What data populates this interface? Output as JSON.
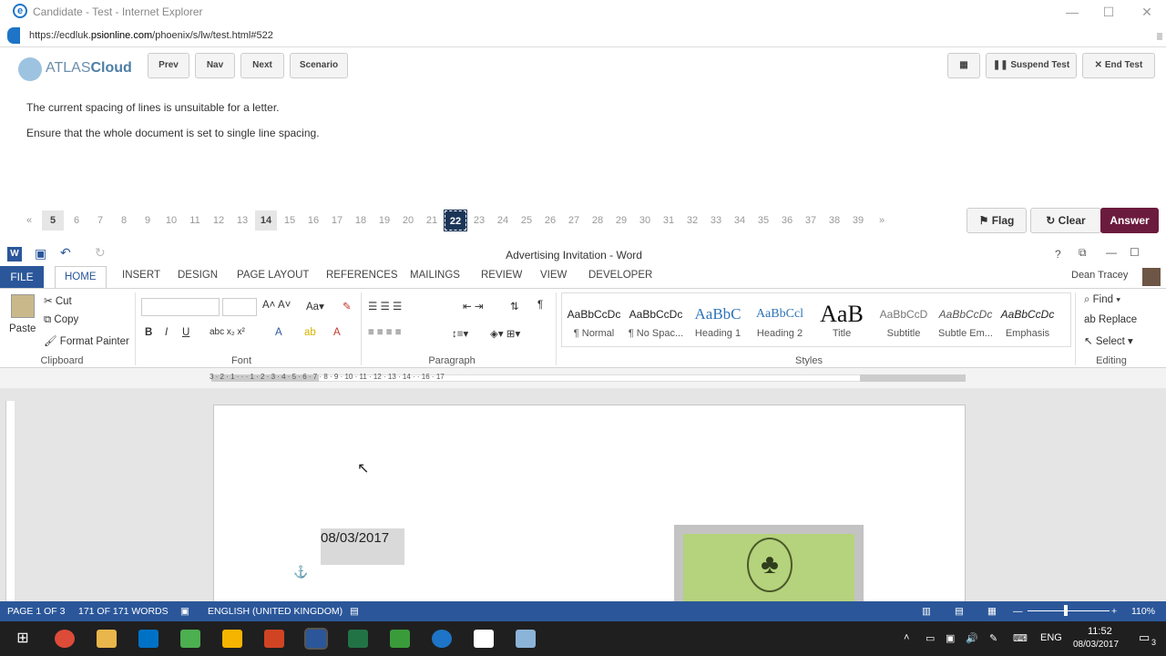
{
  "ie": {
    "title": "Candidate - Test - Internet Explorer",
    "url_prefix": "https://ecdluk.",
    "url_domain": "psionline.com",
    "url_suffix": "/phoenix/s/lw/test.html#522"
  },
  "atlas": {
    "logo_a": "ATLAS",
    "logo_b": "Cloud",
    "prev_label": "Prev",
    "nav_label": "Nav",
    "next_label": "Next",
    "scenario_label": "Scenario",
    "suspend_label": "Suspend Test",
    "end_label": "End Test"
  },
  "question": {
    "line1": "The current spacing of lines is unsuitable for a letter.",
    "line2": "Ensure that the whole document is set to single line spacing."
  },
  "qnav": {
    "prev_arrow": "«",
    "next_arrow": "»",
    "numbers": [
      "5",
      "6",
      "7",
      "8",
      "9",
      "10",
      "11",
      "12",
      "13",
      "14",
      "15",
      "16",
      "17",
      "18",
      "19",
      "20",
      "21",
      "22",
      "23",
      "24",
      "25",
      "26",
      "27",
      "28",
      "29",
      "30",
      "31",
      "32",
      "33",
      "34",
      "35",
      "36",
      "37",
      "38",
      "39"
    ],
    "flag_label": "Flag",
    "clear_label": "Clear",
    "answer_label": "Answer",
    "current": "22",
    "answered": [
      "5",
      "14"
    ]
  },
  "word": {
    "title": "Advertising Invitation - Word",
    "user": "Dean Tracey",
    "tabs": [
      "HOME",
      "INSERT",
      "DESIGN",
      "PAGE LAYOUT",
      "REFERENCES",
      "MAILINGS",
      "REVIEW",
      "VIEW",
      "DEVELOPER"
    ],
    "file_tab": "FILE",
    "clipboard": {
      "paste": "Paste",
      "cut": "Cut",
      "copy": "Copy",
      "format_painter": "Format Painter",
      "label": "Clipboard"
    },
    "font_label": "Font",
    "paragraph_label": "Paragraph",
    "styles_label": "Styles",
    "editing": {
      "find": "Find",
      "replace": "Replace",
      "select": "Select",
      "label": "Editing"
    },
    "styles": [
      {
        "preview": "AaBbCcDc",
        "name": "¶ Normal"
      },
      {
        "preview": "AaBbCcDc",
        "name": "¶ No Spac..."
      },
      {
        "preview": "AaBbC",
        "name": "Heading 1"
      },
      {
        "preview": "AaBbCcl",
        "name": "Heading 2"
      },
      {
        "preview": "AaB",
        "name": "Title"
      },
      {
        "preview": "AaBbCcD",
        "name": "Subtitle"
      },
      {
        "preview": "AaBbCcDc",
        "name": "Subtle Em..."
      },
      {
        "preview": "AaBbCcDc",
        "name": "Emphasis"
      }
    ],
    "ruler_numbers": "3 · 2 · 1 · · · 1 · 2 · 3 · 4 · 5 · 6 · 7 · 8 · 9 · 10 · 11 · 12 · 13 · 14 · · 16 · 17",
    "doc_date": "08/03/2017",
    "status": {
      "page": "PAGE 1 OF 3",
      "words": "171 OF 171 WORDS",
      "language": "ENGLISH (UNITED KINGDOM)",
      "zoom": "110%"
    }
  },
  "taskbar": {
    "lang": "ENG",
    "time": "11:52",
    "date": "08/03/2017",
    "notif_count": "3"
  }
}
